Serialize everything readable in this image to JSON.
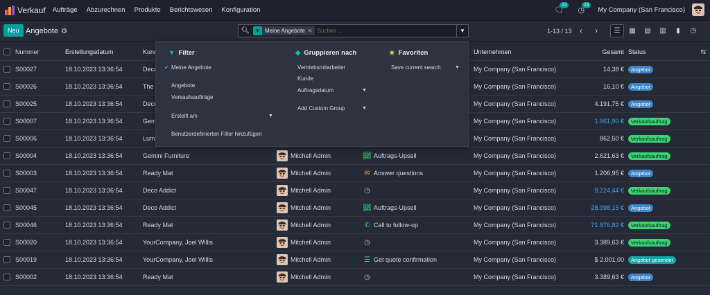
{
  "app": {
    "name": "Verkauf"
  },
  "menu": [
    "Aufträge",
    "Abzurechnen",
    "Produkte",
    "Berichtswesen",
    "Konfiguration"
  ],
  "topright": {
    "messages_count": "22",
    "activities_count": "13",
    "company": "My Company (San Francisco)"
  },
  "control": {
    "new_label": "Neu",
    "breadcrumb": "Angebote",
    "facet": "Meine Angebote",
    "search_placeholder": "Suchen ...",
    "pager": "1-13 / 13"
  },
  "colors": {
    "accent": "#00a09d",
    "blue_tag": "#3a86c8",
    "green_tag": "#36d472",
    "teal_tag": "#17a2a8"
  },
  "table": {
    "headers": {
      "number": "Nummer",
      "date": "Erstellungsdatum",
      "customer": "Kund",
      "company": "Unternehmen",
      "total": "Gesamt",
      "status": "Status"
    },
    "rows": [
      {
        "number": "S00027",
        "date": "18.10.2023 13:36:54",
        "customer": "Deco",
        "seller": "",
        "activity": "",
        "act_icon": "",
        "company": "My Company (San Francisco)",
        "total": "14,38 €",
        "total_blue": false,
        "status": "Angebot",
        "status_color": "blue"
      },
      {
        "number": "S00026",
        "date": "18.10.2023 13:36:54",
        "customer": "The",
        "seller": "",
        "activity": "",
        "act_icon": "",
        "company": "My Company (San Francisco)",
        "total": "16,10 €",
        "total_blue": false,
        "status": "Angebot",
        "status_color": "blue"
      },
      {
        "number": "S00025",
        "date": "18.10.2023 13:36:54",
        "customer": "Deco",
        "seller": "",
        "activity": "",
        "act_icon": "",
        "company": "My Company (San Francisco)",
        "total": "4.191,75 €",
        "total_blue": false,
        "status": "Angebot",
        "status_color": "blue"
      },
      {
        "number": "S00007",
        "date": "18.10.2023 13:36:54",
        "customer": "Gemi",
        "seller": "",
        "activity": "",
        "act_icon": "",
        "company": "My Company (San Francisco)",
        "total": "1.961,90 €",
        "total_blue": true,
        "status": "Verkaufsauftrag",
        "status_color": "green"
      },
      {
        "number": "S00006",
        "date": "18.10.2023 13:36:54",
        "customer": "Lum",
        "seller": "",
        "activity": "",
        "act_icon": "",
        "company": "My Company (San Francisco)",
        "total": "862,50 €",
        "total_blue": false,
        "status": "Verkaufsauftrag",
        "status_color": "green"
      },
      {
        "number": "S00004",
        "date": "18.10.2023 13:36:54",
        "customer": "Gemini Furniture",
        "seller": "Mitchell Admin",
        "activity": "Auftrags-Upsell",
        "act_icon": "chart",
        "company": "My Company (San Francisco)",
        "total": "2.621,63 €",
        "total_blue": false,
        "status": "Verkaufsauftrag",
        "status_color": "green"
      },
      {
        "number": "S00003",
        "date": "18.10.2023 13:36:54",
        "customer": "Ready Mat",
        "seller": "Mitchell Admin",
        "activity": "Answer questions",
        "act_icon": "mail",
        "company": "My Company (San Francisco)",
        "total": "1.206,95 €",
        "total_blue": false,
        "status": "Angebot",
        "status_color": "blue"
      },
      {
        "number": "S00047",
        "date": "18.10.2023 13:36:54",
        "customer": "Deco Addict",
        "seller": "Mitchell Admin",
        "activity": "",
        "act_icon": "clock",
        "company": "My Company (San Francisco)",
        "total": "9.224,44 €",
        "total_blue": true,
        "status": "Verkaufsauftrag",
        "status_color": "green"
      },
      {
        "number": "S00045",
        "date": "18.10.2023 13:36:54",
        "customer": "Deco Addict",
        "seller": "Mitchell Admin",
        "activity": "Auftrags-Upsell",
        "act_icon": "chart",
        "company": "My Company (San Francisco)",
        "total": "28.998,15 €",
        "total_blue": true,
        "status": "Angebot",
        "status_color": "blue"
      },
      {
        "number": "S00046",
        "date": "18.10.2023 13:36:54",
        "customer": "Ready Mat",
        "seller": "Mitchell Admin",
        "activity": "Call to follow-up",
        "act_icon": "phone",
        "company": "My Company (San Francisco)",
        "total": "71.876,82 €",
        "total_blue": true,
        "status": "Verkaufsauftrag",
        "status_color": "green"
      },
      {
        "number": "S00020",
        "date": "18.10.2023 13:36:54",
        "customer": "YourCompany, Joel Willis",
        "seller": "Mitchell Admin",
        "activity": "",
        "act_icon": "clock",
        "company": "My Company (San Francisco)",
        "total": "3.389,63 €",
        "total_blue": false,
        "status": "Verkaufsauftrag",
        "status_color": "green"
      },
      {
        "number": "S00019",
        "date": "18.10.2023 13:36:54",
        "customer": "YourCompany, Joel Willis",
        "seller": "Mitchell Admin",
        "activity": "Get quote confirmation",
        "act_icon": "list",
        "company": "My Company (San Francisco)",
        "total": "$ 2.001,00",
        "total_blue": false,
        "status": "Angebot gesendet",
        "status_color": "teal"
      },
      {
        "number": "S00002",
        "date": "18.10.2023 13:36:54",
        "customer": "Ready Mat",
        "seller": "Mitchell Admin",
        "activity": "",
        "act_icon": "clock",
        "company": "My Company (San Francisco)",
        "total": "3.389,63 €",
        "total_blue": false,
        "status": "Angebot",
        "status_color": "blue"
      }
    ]
  },
  "dropdown": {
    "filter": {
      "title": "Filter",
      "items": [
        "Meine Angebote",
        "Angebote",
        "Verkaufsaufträge",
        "Erstellt am",
        "Benutzerdefinierten Filter hinzufügen"
      ]
    },
    "group": {
      "title": "Gruppieren nach",
      "items": [
        "Vertriebsmitarbeiter",
        "Kunde",
        "Auftragsdatum",
        "Add Custom Group"
      ]
    },
    "favorites": {
      "title": "Favoriten",
      "items": [
        "Save current search"
      ]
    }
  }
}
